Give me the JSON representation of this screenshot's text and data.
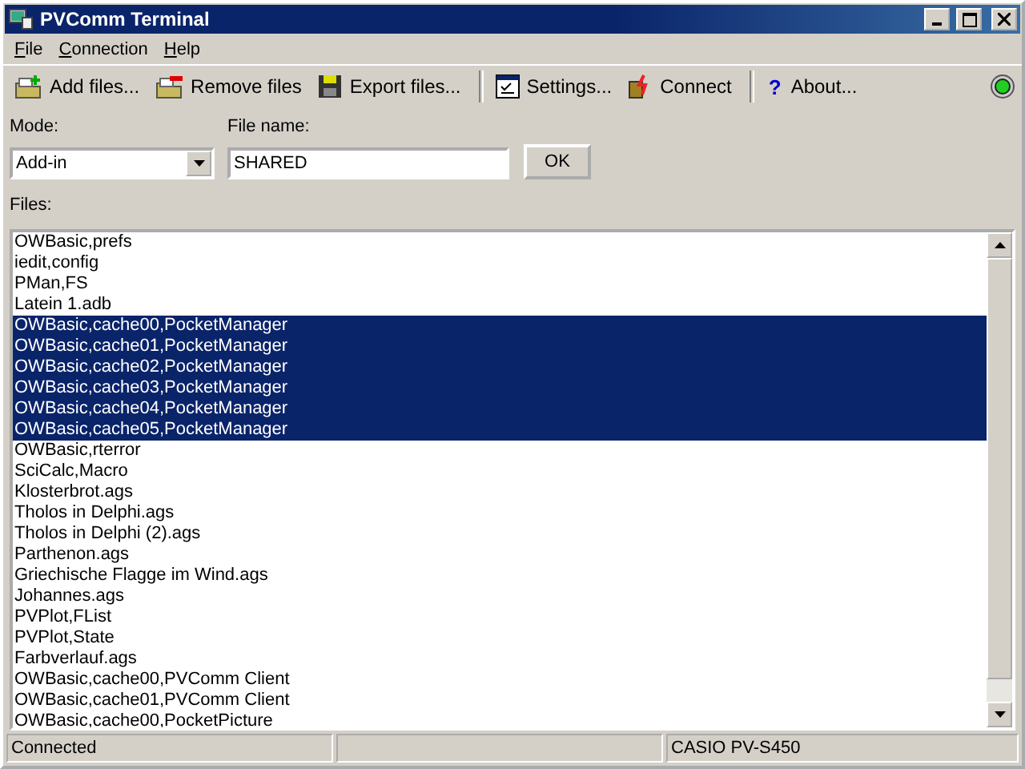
{
  "window": {
    "title": "PVComm Terminal"
  },
  "menu": [
    "File",
    "Connection",
    "Help"
  ],
  "toolbar": [
    {
      "kind": "add",
      "label": "Add files..."
    },
    {
      "kind": "remove",
      "label": "Remove files"
    },
    {
      "kind": "export",
      "label": "Export files..."
    },
    {
      "kind": "separator"
    },
    {
      "kind": "settings",
      "label": "Settings..."
    },
    {
      "kind": "connect",
      "label": "Connect"
    },
    {
      "kind": "separator"
    },
    {
      "kind": "about",
      "glyph": "?",
      "label": "About..."
    }
  ],
  "status_light": {
    "on": true
  },
  "mode": {
    "label": "Mode:",
    "value": "Add-in"
  },
  "file_name": {
    "label": "File name:",
    "value": "SHARED"
  },
  "ok_button": "OK",
  "files": {
    "label": "Files:",
    "items": [
      {
        "name": "OWBasic,prefs",
        "selected": false
      },
      {
        "name": "iedit,config",
        "selected": false
      },
      {
        "name": "PMan,FS",
        "selected": false
      },
      {
        "name": "Latein 1.adb",
        "selected": false
      },
      {
        "name": "OWBasic,cache00,PocketManager",
        "selected": true
      },
      {
        "name": "OWBasic,cache01,PocketManager",
        "selected": true
      },
      {
        "name": "OWBasic,cache02,PocketManager",
        "selected": true
      },
      {
        "name": "OWBasic,cache03,PocketManager",
        "selected": true
      },
      {
        "name": "OWBasic,cache04,PocketManager",
        "selected": true
      },
      {
        "name": "OWBasic,cache05,PocketManager",
        "selected": true
      },
      {
        "name": "OWBasic,rterror",
        "selected": false
      },
      {
        "name": "SciCalc,Macro",
        "selected": false
      },
      {
        "name": "Klosterbrot.ags",
        "selected": false
      },
      {
        "name": "Tholos in Delphi.ags",
        "selected": false
      },
      {
        "name": "Tholos in Delphi (2).ags",
        "selected": false
      },
      {
        "name": "Parthenon.ags",
        "selected": false
      },
      {
        "name": "Griechische Flagge im Wind.ags",
        "selected": false
      },
      {
        "name": "Johannes.ags",
        "selected": false
      },
      {
        "name": "PVPlot,FList",
        "selected": false
      },
      {
        "name": "PVPlot,State",
        "selected": false
      },
      {
        "name": "Farbverlauf.ags",
        "selected": false
      },
      {
        "name": "OWBasic,cache00,PVComm Client",
        "selected": false
      },
      {
        "name": "OWBasic,cache01,PVComm Client",
        "selected": false
      },
      {
        "name": "OWBasic,cache00,PocketPicture",
        "selected": false
      }
    ]
  },
  "status_bar": {
    "connection": "Connected",
    "device": "CASIO PV-S450"
  }
}
